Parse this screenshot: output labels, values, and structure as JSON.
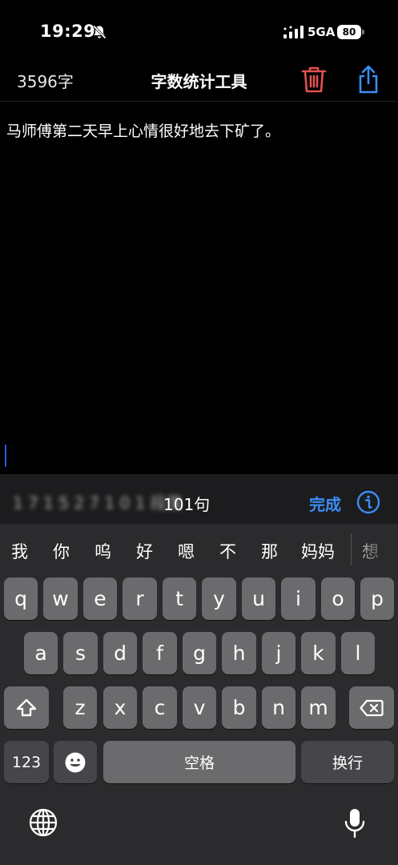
{
  "status_bar": {
    "time": "19:29",
    "network": "5GA",
    "battery": "80",
    "icons": [
      "bell-slash-icon",
      "signal-icon"
    ]
  },
  "nav": {
    "char_count": "3596字",
    "title": "字数统计工具",
    "delete_icon": "trash-icon",
    "share_icon": "share-icon",
    "colors": {
      "delete": "#e2514f",
      "share": "#3a8ef6"
    }
  },
  "editor": {
    "text": "马师傅第二天早上心情很好地去下矿了。"
  },
  "toolbar": {
    "blurred_stat": "1 7 1 5 2 7 1 0 1 段落",
    "sentences": "101句",
    "done_label": "完成",
    "info_icon": "info-icon",
    "accent": "#3a8ef6"
  },
  "keyboard": {
    "candidates": [
      "我",
      "你",
      "呜",
      "好",
      "嗯",
      "不",
      "那",
      "妈妈",
      "想"
    ],
    "rows": [
      [
        "q",
        "w",
        "e",
        "r",
        "t",
        "y",
        "u",
        "i",
        "o",
        "p"
      ],
      [
        "a",
        "s",
        "d",
        "f",
        "g",
        "h",
        "j",
        "k",
        "l"
      ],
      [
        "z",
        "x",
        "c",
        "v",
        "b",
        "n",
        "m"
      ]
    ],
    "shift_icon": "shift-icon",
    "delete_icon": "backspace-icon",
    "numbers_label": "123",
    "emoji_icon": "emoji-icon",
    "space_label": "空格",
    "return_label": "换行",
    "globe_icon": "globe-icon",
    "mic_icon": "microphone-icon"
  }
}
